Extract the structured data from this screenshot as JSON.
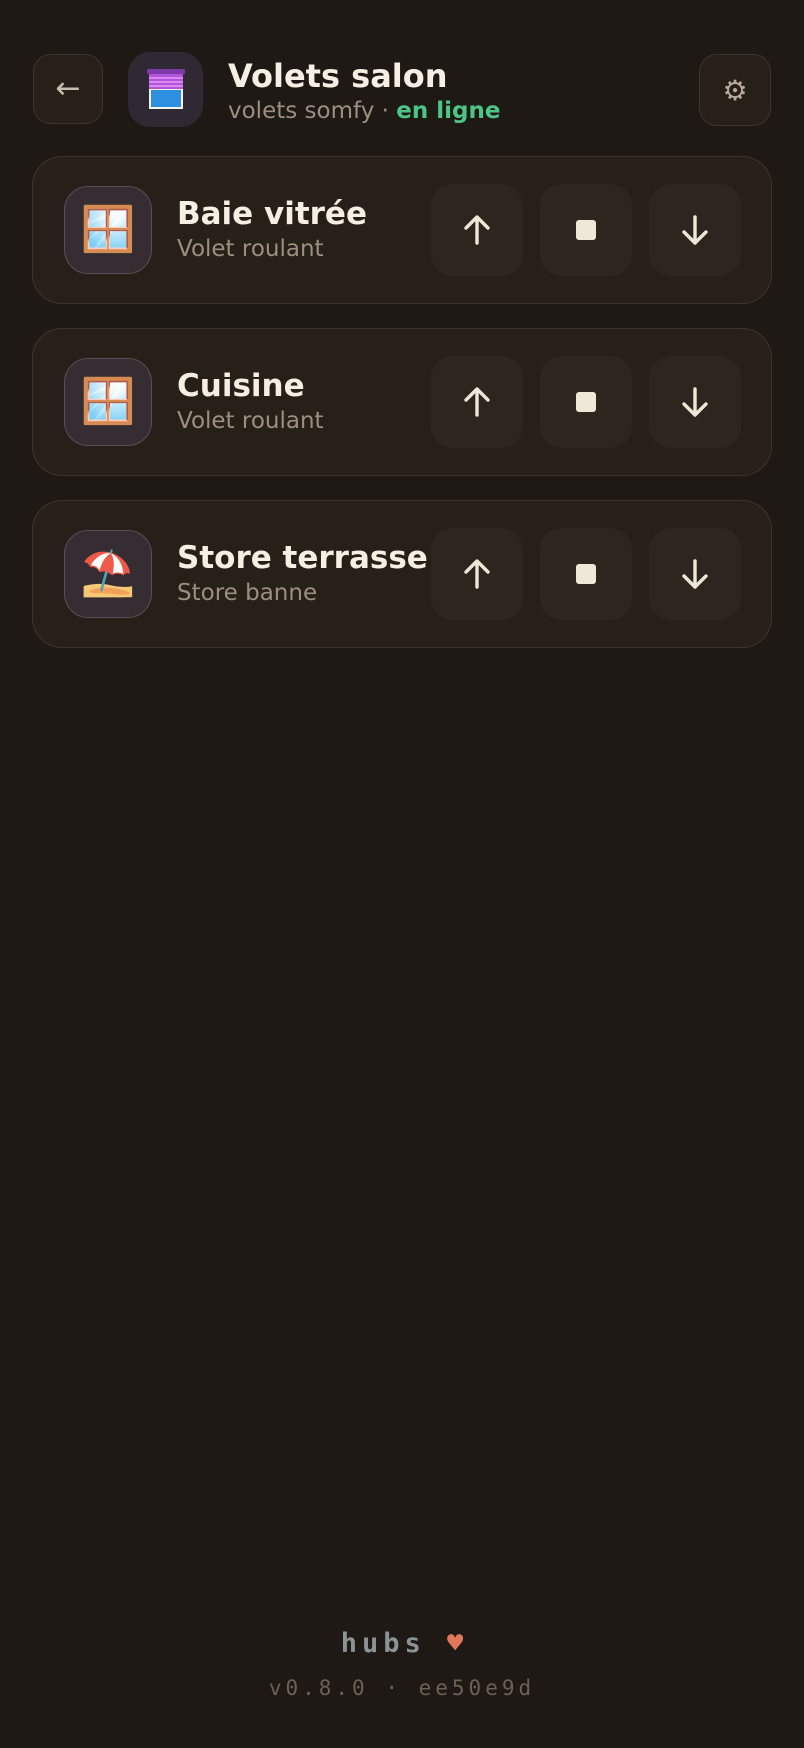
{
  "header": {
    "back_icon": "arrow-left-icon",
    "back_glyph": "←",
    "app_icon": "window-blind-icon",
    "title": "Volets salon",
    "subtitle_device": "volets somfy",
    "subtitle_separator": "·",
    "status": "en ligne",
    "status_color": "#4cc684",
    "settings_icon": "gear-icon",
    "settings_glyph": "⚙"
  },
  "devices": [
    {
      "name": "Baie vitrée",
      "type": "Volet roulant",
      "icon": "window-icon",
      "emoji": "🪟",
      "controls": [
        "arrow-up-icon",
        "stop-icon",
        "arrow-down-icon"
      ]
    },
    {
      "name": "Cuisine",
      "type": "Volet roulant",
      "icon": "window-icon",
      "emoji": "🪟",
      "controls": [
        "arrow-up-icon",
        "stop-icon",
        "arrow-down-icon"
      ]
    },
    {
      "name": "Store terrasse",
      "type": "Store banne",
      "icon": "beach-umbrella-icon",
      "emoji": "⛱️",
      "controls": [
        "arrow-up-icon",
        "stop-icon",
        "arrow-down-icon"
      ]
    }
  ],
  "footer": {
    "brand": "hubs",
    "heart": "♥",
    "version": "v0.8.0 · ee50e9d"
  },
  "colors": {
    "background": "#1e1915",
    "card": "#262019",
    "accent_online": "#4cc684",
    "heart": "#e0785a"
  }
}
